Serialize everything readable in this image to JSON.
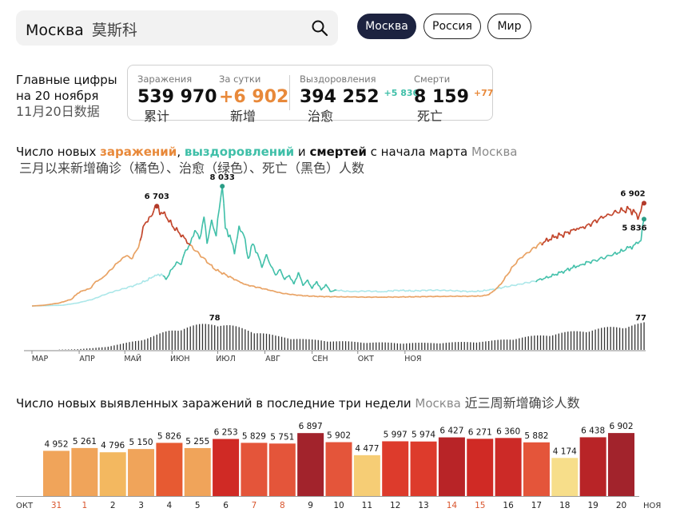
{
  "search": {
    "city": "Москва",
    "city_cn": "莫斯科",
    "icon": "search-icon"
  },
  "regions": [
    {
      "label": "Москва",
      "active": true
    },
    {
      "label": "Россия",
      "active": false
    },
    {
      "label": "Мир",
      "active": false
    }
  ],
  "summary": {
    "title_line1": "Главные цифры",
    "title_line2": "на 20 ноября",
    "title_cn": "11月20日数据",
    "stats": [
      {
        "label": "Заражения",
        "value": "539 970",
        "delta": "",
        "cn": "累计",
        "value_color": "#111111"
      },
      {
        "label": "За сутки",
        "value": "+6 902",
        "delta": "",
        "cn": "新增",
        "value_color": "#e8893a"
      },
      {
        "label": "Выздоровления",
        "value": "394 252",
        "delta": "+5 836",
        "delta_color": "#3fbfa8",
        "cn": "治愈",
        "value_color": "#111111"
      },
      {
        "label": "Смерти",
        "value": "8 159",
        "delta": "+77",
        "delta_color": "#e8893a",
        "cn": "死亡",
        "value_color": "#111111"
      }
    ]
  },
  "main_chart": {
    "title_parts": [
      "Число новых ",
      "заражений",
      ", ",
      "выздоровлений",
      " и ",
      "смертей",
      " с начала марта",
      "Москва"
    ],
    "subtitle_cn": "三月以来新增确诊（橘色）、治愈（绿色）、死亡（黑色）人数"
  },
  "bottom_chart": {
    "title": "Число новых выявленных заражений в последние три недели",
    "region": "Москва",
    "title_cn": "近三周新增确诊人数"
  },
  "chart_data": [
    {
      "type": "line",
      "x_ticks": [
        "МАР",
        "АПР",
        "МАЙ",
        "ИЮН",
        "ИЮЛ",
        "АВГ",
        "СЕН",
        "ОКТ",
        "НОЯ"
      ],
      "series": [
        {
          "color": "#e8893a",
          "annotations": [
            {
              "label": "6 703",
              "value": 6703
            },
            {
              "label": "6 902",
              "value": 6902
            }
          ],
          "anchors": [
            [
              0,
              50
            ],
            [
              8,
              100
            ],
            [
              18,
              250
            ],
            [
              26,
              500
            ],
            [
              30,
              900
            ],
            [
              34,
              1100
            ],
            [
              38,
              1200
            ],
            [
              42,
              1700
            ],
            [
              46,
              1900
            ],
            [
              50,
              2300
            ],
            [
              54,
              2700
            ],
            [
              57,
              3000
            ],
            [
              59,
              3200
            ],
            [
              62,
              3400
            ],
            [
              65,
              3200
            ],
            [
              69,
              3800
            ],
            [
              72,
              4700
            ],
            [
              74,
              5500
            ],
            [
              77,
              6000
            ],
            [
              79,
              6100
            ],
            [
              80,
              6400
            ],
            [
              82,
              6703
            ],
            [
              85,
              6300
            ],
            [
              88,
              6000
            ],
            [
              92,
              5400
            ],
            [
              96,
              5000
            ],
            [
              100,
              4600
            ],
            [
              104,
              4100
            ],
            [
              108,
              3700
            ],
            [
              112,
              3300
            ],
            [
              116,
              2900
            ],
            [
              120,
              2500
            ],
            [
              124,
              2300
            ],
            [
              128,
              2100
            ],
            [
              132,
              1900
            ],
            [
              136,
              1700
            ],
            [
              140,
              1500
            ],
            [
              144,
              1400
            ],
            [
              148,
              1300
            ],
            [
              152,
              1200
            ],
            [
              156,
              1100
            ],
            [
              160,
              1000
            ],
            [
              164,
              900
            ],
            [
              168,
              850
            ],
            [
              172,
              800
            ],
            [
              176,
              760
            ],
            [
              180,
              720
            ],
            [
              184,
              700
            ],
            [
              190,
              680
            ],
            [
              200,
              660
            ],
            [
              210,
              650
            ],
            [
              220,
              640
            ],
            [
              230,
              640
            ],
            [
              240,
              650
            ],
            [
              250,
              660
            ],
            [
              260,
              680
            ],
            [
              270,
              690
            ],
            [
              280,
              700
            ],
            [
              290,
              700
            ],
            [
              296,
              720
            ],
            [
              300,
              800
            ],
            [
              304,
              1100
            ],
            [
              308,
              1500
            ],
            [
              312,
              2100
            ],
            [
              316,
              2700
            ],
            [
              320,
              3200
            ],
            [
              324,
              3500
            ],
            [
              328,
              3800
            ],
            [
              332,
              4100
            ],
            [
              336,
              4300
            ],
            [
              340,
              4500
            ],
            [
              344,
              4700
            ],
            [
              348,
              4800
            ],
            [
              352,
              5000
            ],
            [
              356,
              5200
            ],
            [
              360,
              5300
            ],
            [
              364,
              5400
            ],
            [
              368,
              5600
            ],
            [
              372,
              5800
            ],
            [
              376,
              6000
            ],
            [
              380,
              6100
            ],
            [
              384,
              6300
            ],
            [
              388,
              6400
            ],
            [
              392,
              6500
            ],
            [
              396,
              6300
            ],
            [
              398,
              5800
            ],
            [
              400,
              6400
            ],
            [
              402,
              6902
            ]
          ]
        },
        {
          "color": "#3fbfa8",
          "annotations": [
            {
              "label": "8 033",
              "value": 8033
            },
            {
              "label": "5 836",
              "value": 5836
            }
          ],
          "anchors": [
            [
              0,
              50
            ],
            [
              20,
              100
            ],
            [
              30,
              250
            ],
            [
              40,
              500
            ],
            [
              50,
              900
            ],
            [
              60,
              1200
            ],
            [
              70,
              1500
            ],
            [
              80,
              2000
            ],
            [
              85,
              2200
            ],
            [
              88,
              1800
            ],
            [
              92,
              2500
            ],
            [
              95,
              3000
            ],
            [
              98,
              2800
            ],
            [
              101,
              3800
            ],
            [
              104,
              4200
            ],
            [
              107,
              5100
            ],
            [
              110,
              4500
            ],
            [
              113,
              6000
            ],
            [
              115,
              4200
            ],
            [
              118,
              5800
            ],
            [
              121,
              4700
            ],
            [
              123,
              6500
            ],
            [
              125,
              8033
            ],
            [
              127,
              5200
            ],
            [
              130,
              4800
            ],
            [
              133,
              3500
            ],
            [
              136,
              5400
            ],
            [
              139,
              4800
            ],
            [
              142,
              3200
            ],
            [
              145,
              4200
            ],
            [
              148,
              3600
            ],
            [
              151,
              2600
            ],
            [
              154,
              3500
            ],
            [
              157,
              2700
            ],
            [
              160,
              2100
            ],
            [
              163,
              2500
            ],
            [
              166,
              1800
            ],
            [
              169,
              2100
            ],
            [
              172,
              1500
            ],
            [
              175,
              2300
            ],
            [
              178,
              1400
            ],
            [
              181,
              1800
            ],
            [
              184,
              1200
            ],
            [
              187,
              1700
            ],
            [
              190,
              1100
            ],
            [
              193,
              1500
            ],
            [
              196,
              1000
            ],
            [
              200,
              1100
            ],
            [
              210,
              1000
            ],
            [
              220,
              1050
            ],
            [
              230,
              1000
            ],
            [
              240,
              1100
            ],
            [
              250,
              1050
            ],
            [
              260,
              1100
            ],
            [
              270,
              1100
            ],
            [
              280,
              1050
            ],
            [
              290,
              1000
            ],
            [
              300,
              1100
            ],
            [
              310,
              1300
            ],
            [
              320,
              1500
            ],
            [
              330,
              1700
            ],
            [
              340,
              2000
            ],
            [
              350,
              2400
            ],
            [
              360,
              2800
            ],
            [
              370,
              3100
            ],
            [
              380,
              3400
            ],
            [
              385,
              3600
            ],
            [
              390,
              3800
            ],
            [
              395,
              4100
            ],
            [
              398,
              4200
            ],
            [
              400,
              4400
            ],
            [
              402,
              5836
            ]
          ]
        },
        {
          "color": "#111111",
          "type": "bar",
          "annotations": [
            {
              "label": "78",
              "value": 78
            },
            {
              "label": "77",
              "value": 77
            }
          ],
          "anchors": [
            [
              0,
              0
            ],
            [
              10,
              0
            ],
            [
              20,
              1
            ],
            [
              30,
              2
            ],
            [
              40,
              5
            ],
            [
              50,
              10
            ],
            [
              60,
              18
            ],
            [
              70,
              28
            ],
            [
              80,
              40
            ],
            [
              90,
              55
            ],
            [
              100,
              65
            ],
            [
              110,
              72
            ],
            [
              117,
              76
            ],
            [
              120,
              78
            ],
            [
              125,
              74
            ],
            [
              130,
              70
            ],
            [
              140,
              60
            ],
            [
              150,
              50
            ],
            [
              160,
              40
            ],
            [
              170,
              35
            ],
            [
              180,
              30
            ],
            [
              190,
              28
            ],
            [
              200,
              25
            ],
            [
              220,
              22
            ],
            [
              240,
              20
            ],
            [
              260,
              20
            ],
            [
              280,
              22
            ],
            [
              300,
              25
            ],
            [
              320,
              35
            ],
            [
              340,
              45
            ],
            [
              360,
              55
            ],
            [
              370,
              60
            ],
            [
              380,
              65
            ],
            [
              390,
              70
            ],
            [
              400,
              75
            ],
            [
              402,
              77
            ]
          ]
        }
      ]
    },
    {
      "type": "bar",
      "categories": [
        "31",
        "1",
        "2",
        "3",
        "4",
        "5",
        "6",
        "7",
        "8",
        "9",
        "10",
        "11",
        "12",
        "13",
        "14",
        "15",
        "16",
        "17",
        "18",
        "19",
        "20"
      ],
      "values": [
        4952,
        5261,
        4796,
        5150,
        5826,
        5255,
        6253,
        5829,
        5751,
        6897,
        5902,
        4477,
        5997,
        5974,
        6427,
        6271,
        6360,
        5882,
        4174,
        6438,
        6902
      ],
      "labels": [
        "4 952",
        "5 261",
        "4 796",
        "5 150",
        "5 826",
        "5 255",
        "6 253",
        "5 829",
        "5 751",
        "6 897",
        "5 902",
        "4 477",
        "5 997",
        "5 974",
        "6 427",
        "6 271",
        "6 360",
        "5 882",
        "4 174",
        "6 438",
        "6 902"
      ],
      "colors": [
        "#f0a45a",
        "#f0a45a",
        "#f3b860",
        "#f0a45a",
        "#e75a32",
        "#f0a45a",
        "#d02a25",
        "#e4553a",
        "#e4553a",
        "#a2232c",
        "#e4553a",
        "#f6cd75",
        "#dd3b2c",
        "#dd3b2c",
        "#b82427",
        "#d02a25",
        "#cc2a27",
        "#e4553a",
        "#f7de8a",
        "#b82427",
        "#a2232c"
      ],
      "tick_colors": [
        "#d9552d",
        "#d9552d",
        "#222222",
        "#222222",
        "#222222",
        "#222222",
        "#222222",
        "#d9552d",
        "#d9552d",
        "#222222",
        "#222222",
        "#222222",
        "#222222",
        "#222222",
        "#d9552d",
        "#d9552d",
        "#222222",
        "#222222",
        "#222222",
        "#222222",
        "#222222"
      ],
      "x_start": "ОКТ",
      "x_end": "НОЯ"
    }
  ]
}
